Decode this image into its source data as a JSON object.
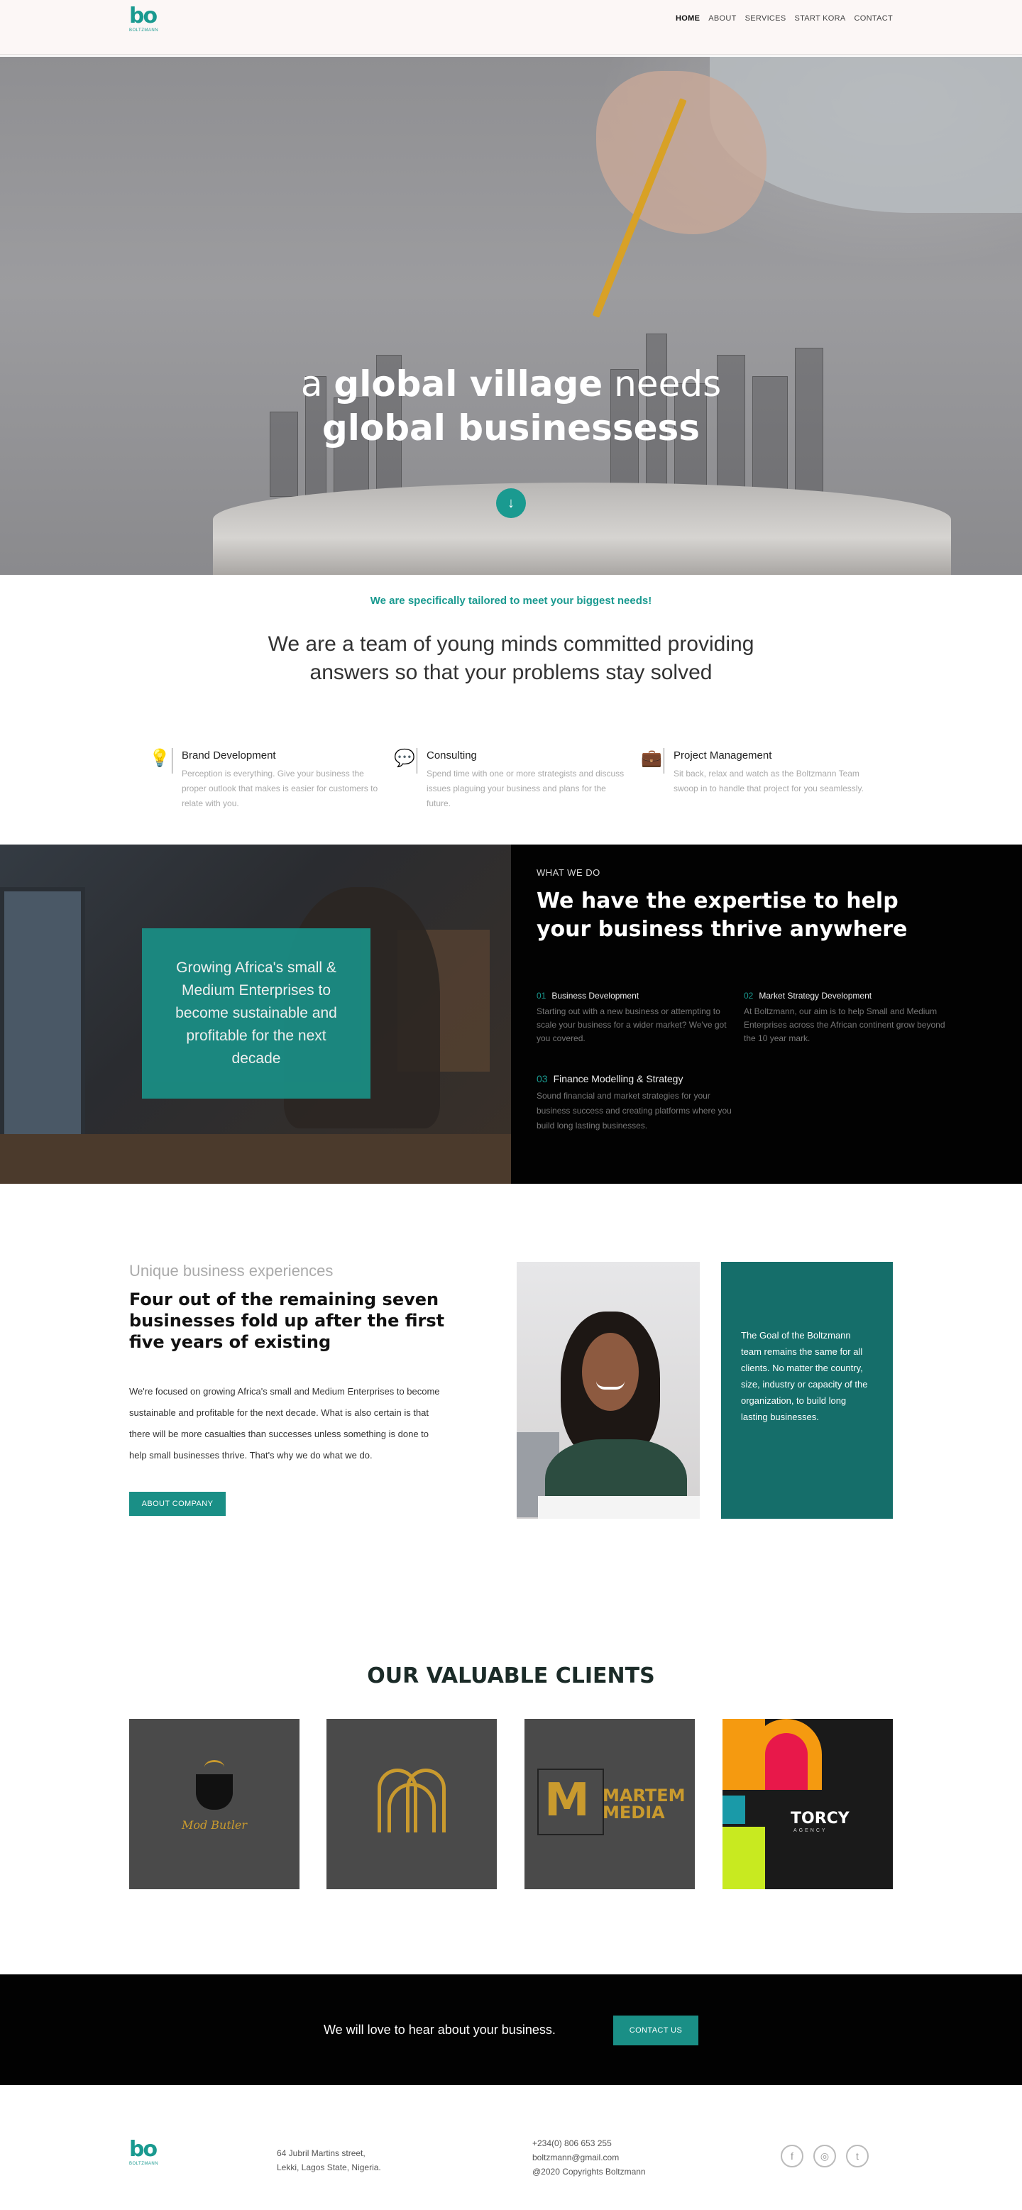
{
  "nav": {
    "logo_mark": "bo",
    "logo_sub": "BOLTZMANN",
    "items": [
      {
        "label": "HOME",
        "active": true
      },
      {
        "label": "ABOUT",
        "active": false
      },
      {
        "label": "SERVICES",
        "active": false
      },
      {
        "label": "START KORA",
        "active": false
      },
      {
        "label": "CONTACT",
        "active": false
      }
    ]
  },
  "hero": {
    "line1_a": "a ",
    "line1_b": "global village",
    "line1_c": " needs",
    "line2": "global businessess",
    "scroll_icon": "arrow-down-icon"
  },
  "intro": {
    "tagline": "We are specifically tailored to meet your biggest needs!",
    "statement": "We are a team of young minds committed providing answers so that your problems stay solved"
  },
  "services": [
    {
      "icon": "lightbulb-icon",
      "title": "Brand Development",
      "desc": "Perception is everything. Give your business the proper outlook that makes is easier for customers to relate with you."
    },
    {
      "icon": "chat-bubble-icon",
      "title": "Consulting",
      "desc": "Spend time with one or more strategists and discuss issues plaguing your business and plans for the future."
    },
    {
      "icon": "briefcase-icon",
      "title": "Project Management",
      "desc": "Sit back, relax and watch as the Boltzmann Team swoop in to handle that project for you seamlessly."
    }
  ],
  "what_we_do": {
    "card_text": "Growing Africa's small & Medium Enterprises to become sustainable and profitable for the next decade",
    "label": "WHAT WE DO",
    "heading": "We have the expertise to help your business thrive anywhere",
    "features": [
      {
        "num": "01",
        "title": "Business Development",
        "desc": "Starting out with a new business or attempting to scale your business for a wider market? We've got you covered."
      },
      {
        "num": "02",
        "title": "Market Strategy Development",
        "desc": "At Boltzmann, our aim is to help Small and Medium Enterprises across the African continent grow beyond the 10 year mark."
      },
      {
        "num": "03",
        "title": "Finance Modelling & Strategy",
        "desc": "Sound financial and market strategies for your business success and creating platforms where you build long lasting businesses."
      }
    ]
  },
  "unique": {
    "eyebrow": "Unique business experiences",
    "title": "Four out of the remaining seven businesses fold up after the first five years of existing",
    "body": "We're focused on growing Africa's small and Medium Enterprises to become sustainable and profitable for the next decade. What is also certain is that there will be more casualties than successes unless something is done to help small businesses thrive. That's why we do what we do.",
    "button": "ABOUT COMPANY",
    "goal": "The Goal of the Boltzmann team remains the same for all clients. No matter the country, size, industry or capacity of the organization, to build long lasting businesses."
  },
  "clients": {
    "title": "OUR VALUABLE CLIENTS",
    "logos": [
      {
        "name": "Mod Butler",
        "text": "Mod Butler"
      },
      {
        "name": "M arch",
        "text": ""
      },
      {
        "name": "Martem Media",
        "letter": "M",
        "text_line1": "MARTEM",
        "text_line2": "MEDIA"
      },
      {
        "name": "Torcy",
        "text": "TORCY",
        "sub": "AGENCY"
      }
    ]
  },
  "cta": {
    "message": "We will love to hear about your business.",
    "button": "CONTACT US"
  },
  "footer": {
    "address_line1": "64 Jubril Martins street,",
    "address_line2": "Lekki, Lagos State, Nigeria.",
    "phone": "+234(0) 806 653 255",
    "email": "boltzmann@gmail.com",
    "copyright": "@2020 Copyrights Boltzmann",
    "socials": [
      {
        "icon": "facebook-icon",
        "glyph": "f"
      },
      {
        "icon": "instagram-icon",
        "glyph": "◎"
      },
      {
        "icon": "twitter-icon",
        "glyph": "t"
      }
    ]
  }
}
